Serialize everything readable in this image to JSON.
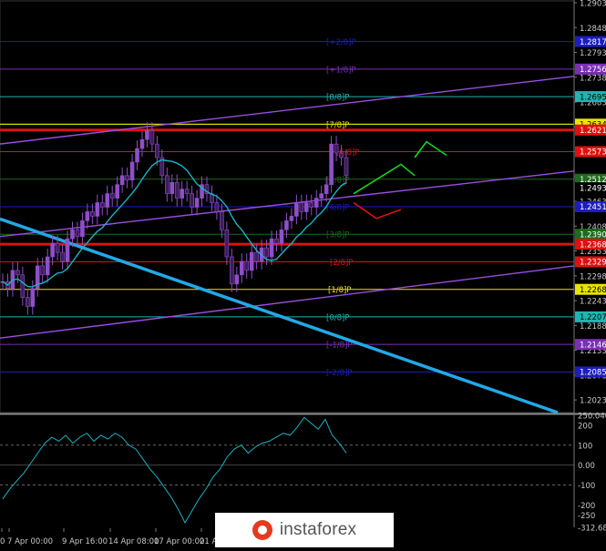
{
  "chart_data": [
    {
      "type": "candlestick",
      "title": "",
      "ylim": [
        1.1995,
        1.2903
      ],
      "y_axis_ticks": [
        "1.2903",
        "1.2848",
        "1.2793",
        "1.2738",
        "1.2683",
        "1.2628",
        "1.2573",
        "1.2518",
        "1.2463",
        "1.2408",
        "1.2353",
        "1.2298",
        "1.2243",
        "1.2188",
        "1.2133",
        "1.2078",
        "1.2023"
      ],
      "y_axis_highlight_labels": [
        {
          "label": "1.2817",
          "value": 1.2817,
          "color": "#1d1dbe"
        },
        {
          "label": "1.2756",
          "value": 1.2756,
          "color": "#7b2fb5"
        },
        {
          "label": "1.2695",
          "value": 1.2695,
          "color": "#1bb7b0"
        },
        {
          "label": "1.2634",
          "value": 1.2634,
          "color": "#e9e300"
        },
        {
          "label": "1.2621",
          "value": 1.2621,
          "color": "#e01010"
        },
        {
          "label": "1.2573",
          "value": 1.2573,
          "color": "#e01010"
        },
        {
          "label": "1.2512",
          "value": 1.2512,
          "color": "#1e6b1e"
        },
        {
          "label": "1.2493",
          "value": 1.2493,
          "color": "#000000"
        },
        {
          "label": "1.2451",
          "value": 1.2451,
          "color": "#1d1dbe"
        },
        {
          "label": "1.2390",
          "value": 1.239,
          "color": "#1e6b1e"
        },
        {
          "label": "1.2368",
          "value": 1.2368,
          "color": "#e01010"
        },
        {
          "label": "1.2329",
          "value": 1.2329,
          "color": "#e01010"
        },
        {
          "label": "1.2268",
          "value": 1.2268,
          "color": "#e9e300"
        },
        {
          "label": "1.2207",
          "value": 1.2207,
          "color": "#1bb7b0"
        },
        {
          "label": "1.2146",
          "value": 1.2146,
          "color": "#7b2fb5"
        },
        {
          "label": "1.2085",
          "value": 1.2085,
          "color": "#1d1dbe"
        }
      ],
      "murrey_levels": [
        {
          "label": "[+2/8]P",
          "value": 1.2817,
          "color": "#1d1dbe"
        },
        {
          "label": "[+1/8]P",
          "value": 1.2756,
          "color": "#7b2fb5"
        },
        {
          "label": "[8/8]P",
          "value": 1.2695,
          "color": "#1bb7b0"
        },
        {
          "label": "[7/8]P",
          "value": 1.2634,
          "color": "#e9e300"
        },
        {
          "label": "[6/8]P",
          "value": 1.2573,
          "color": "#e01010"
        },
        {
          "label": "[5/8]P",
          "value": 1.2512,
          "color": "#1e6b1e"
        },
        {
          "label": "[4/8]P",
          "value": 1.2451,
          "color": "#1d1dbe"
        },
        {
          "label": "[3/8]P",
          "value": 1.239,
          "color": "#1e6b1e"
        },
        {
          "label": "[2/8]P",
          "value": 1.2329,
          "color": "#e01010"
        },
        {
          "label": "[1/8]P",
          "value": 1.2268,
          "color": "#e9e300"
        },
        {
          "label": "[0/8]P",
          "value": 1.2207,
          "color": "#1bb7b0"
        },
        {
          "label": "[-1/8]P",
          "value": 1.2146,
          "color": "#7b2fb5"
        },
        {
          "label": "[-2/8]P",
          "value": 1.2085,
          "color": "#1d1dbe"
        }
      ],
      "key_red_lines": [
        1.2621,
        1.2368
      ],
      "x_axis_labels": [
        "0",
        "7 Apr 00:00",
        "9 Apr 16:00",
        "14 Apr 08:00",
        "17 Apr 00:00",
        "21 Apr"
      ],
      "candle_color": "#8f4fc9",
      "ma_color": "#19b3c4",
      "forecast_up_color": "#19d419",
      "forecast_down_color": "#e01010",
      "trendline_colors": {
        "channel": "#9a4de0",
        "downtrend": "#22a8e6"
      }
    },
    {
      "type": "line",
      "name": "CCI",
      "ylim": [
        -312.6821,
        250.0403
      ],
      "y_axis_ticks": [
        "250.0403",
        "200",
        "100",
        "0.00",
        "-100",
        "-200",
        "-250",
        "-312.6821"
      ],
      "grid_dashed_at": [
        100,
        -100
      ],
      "color": "#19b3c4"
    }
  ],
  "watermark": {
    "text": "instaforex",
    "logo": "instaforex-logo"
  }
}
